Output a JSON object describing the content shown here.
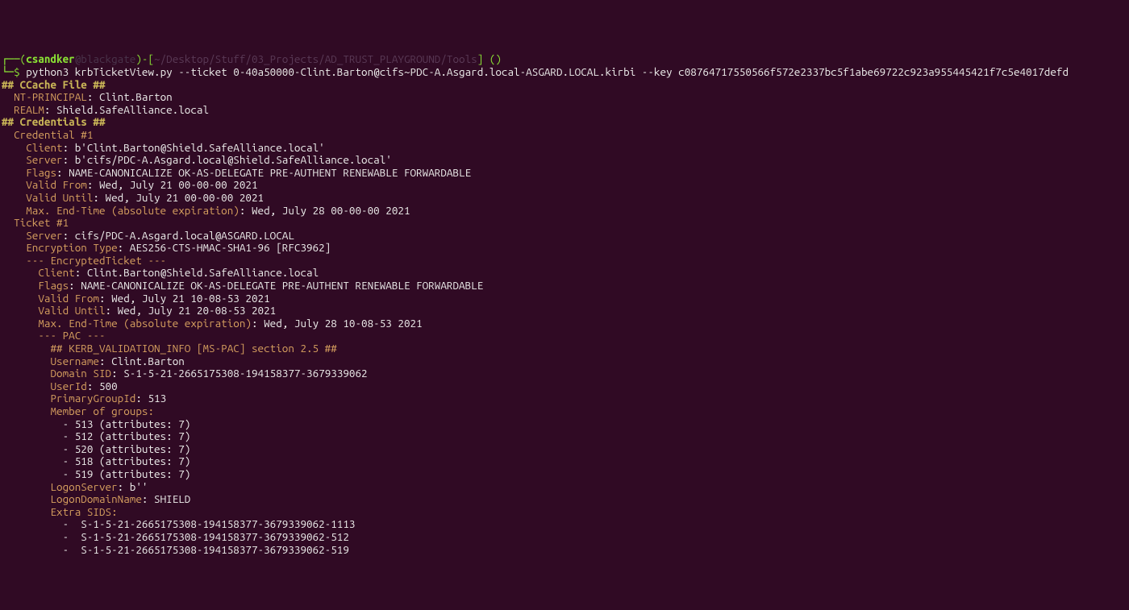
{
  "prompt": {
    "open_paren": "┌──(",
    "user": "csandker",
    "at": "@",
    "host": "blackgate",
    "close_userhost": ")-[",
    "cwd": "~/Desktop/Stuff/03_Projects/AD_TRUST_PLAYGROUND/Tools",
    "close_bracket": "] ()",
    "line2_prefix": "└─",
    "dollar": "$ ",
    "command": "python3 krbTicketView.py --ticket 0-40a50000-Clint.Barton@cifs~PDC-A.Asgard.local-ASGARD.LOCAL.kirbi --key c08764717550566f572e2337bc5f1abe69722c923a955445421f7c5e4017defd"
  },
  "out": {
    "hdr_ccache": "## CCache File ##",
    "nt_principal_k": "  NT-PRINCIPAL",
    "nt_principal_v": ": Clint.Barton",
    "realm_k": "  REALM",
    "realm_v": ": Shield.SafeAlliance.local",
    "hdr_creds": "## Credentials ##",
    "cred_hdr": "  Credential #1",
    "client_k": "    Client",
    "client_v": ": b'Clint.Barton@Shield.SafeAlliance.local'",
    "server_k": "    Server",
    "server_v": ": b'cifs/PDC-A.Asgard.local@Shield.SafeAlliance.local'",
    "flags_k": "    Flags",
    "flags_v": ": NAME-CANONICALIZE OK-AS-DELEGATE PRE-AUTHENT RENEWABLE FORWARDABLE",
    "valid_from_k": "    Valid From",
    "valid_from_v": ": Wed, July 21 00-00-00 2021",
    "valid_until_k": "    Valid Until",
    "valid_until_v": ": Wed, July 21 00-00-00 2021",
    "max_end_k": "    Max. End-Time (absolute expiration)",
    "max_end_v": ": Wed, July 28 00-00-00 2021",
    "ticket_hdr": "  Ticket #1",
    "t_server_k": "    Server",
    "t_server_v": ": cifs/PDC-A.Asgard.local@ASGARD.LOCAL",
    "t_enc_k": "    Encryption Type",
    "t_enc_v": ": AES256-CTS-HMAC-SHA1-96 [RFC3962]",
    "enc_ticket_hdr": "    --- EncryptedTicket ---",
    "et_client_k": "      Client",
    "et_client_v": ": Clint.Barton@Shield.SafeAlliance.local",
    "et_flags_k": "      Flags",
    "et_flags_v": ": NAME-CANONICALIZE OK-AS-DELEGATE PRE-AUTHENT RENEWABLE FORWARDABLE",
    "et_vf_k": "      Valid From",
    "et_vf_v": ": Wed, July 21 10-08-53 2021",
    "et_vu_k": "      Valid Until",
    "et_vu_v": ": Wed, July 21 20-08-53 2021",
    "et_me_k": "      Max. End-Time (absolute expiration)",
    "et_me_v": ": Wed, July 28 10-08-53 2021",
    "pac_hdr": "      --- PAC ---",
    "kvi_hdr": "        ## KERB_VALIDATION_INFO [MS-PAC] section 2.5 ##",
    "uname_k": "        Username",
    "uname_v": ": Clint.Barton",
    "dsid_k": "        Domain SID",
    "dsid_v": ": S-1-5-21-2665175308-194158377-3679339062",
    "uid_k": "        UserId",
    "uid_v": ": 500",
    "pgid_k": "        PrimaryGroupId",
    "pgid_v": ": 513",
    "mog_hdr": "        Member of groups:",
    "mog_1": "          - 513 (attributes: 7)",
    "mog_2": "          - 512 (attributes: 7)",
    "mog_3": "          - 520 (attributes: 7)",
    "mog_4": "          - 518 (attributes: 7)",
    "mog_5": "          - 519 (attributes: 7)",
    "ls_k": "        LogonServer",
    "ls_v": ": b''",
    "ldn_k": "        LogonDomainName",
    "ldn_v": ": SHIELD",
    "esids_hdr": "        Extra SIDS:",
    "esid_1": "          -  S-1-5-21-2665175308-194158377-3679339062-1113",
    "esid_2": "          -  S-1-5-21-2665175308-194158377-3679339062-512",
    "esid_3": "          -  S-1-5-21-2665175308-194158377-3679339062-519"
  }
}
